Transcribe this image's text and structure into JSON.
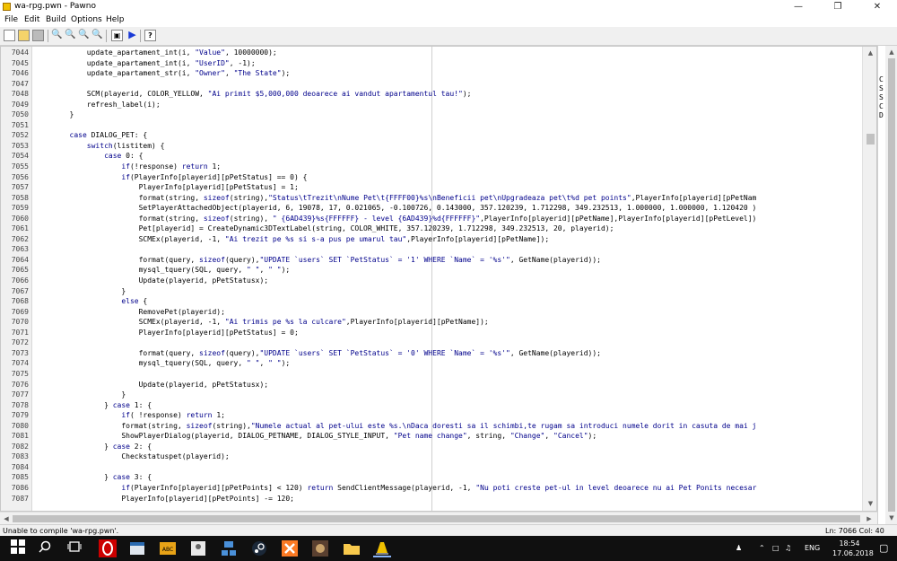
{
  "window": {
    "title": "wa-rpg.pwn - Pawno",
    "minimize": "—",
    "maximize": "❐",
    "close": "✕"
  },
  "menu": [
    "File",
    "Edit",
    "Build",
    "Options",
    "Help"
  ],
  "toolbar": {
    "icons": [
      "new-file-icon",
      "open-file-icon",
      "save-icon",
      "find-icon",
      "find-next-icon",
      "replace-icon",
      "goto-line-icon",
      "compile-icon",
      "run-icon",
      "help-icon"
    ]
  },
  "editor": {
    "line_numbers": [
      "7044",
      "7045",
      "7046",
      "7047",
      "7048",
      "7049",
      "7050",
      "7051",
      "7052",
      "7053",
      "7054",
      "7055",
      "7056",
      "7057",
      "7058",
      "7059",
      "7060",
      "7061",
      "7062",
      "7063",
      "7064",
      "7065",
      "7066",
      "7067",
      "7068",
      "7069",
      "7070",
      "7071",
      "7072",
      "7073",
      "7074",
      "7075",
      "7076",
      "7077",
      "7078",
      "7079",
      "7080",
      "7081",
      "7082",
      "7083",
      "7084",
      "7085",
      "7086",
      "7087"
    ],
    "lines": [
      "            update_apartament_int(i, \"Value\", 10000000);",
      "            update_apartament_int(i, \"UserID\", -1);",
      "            update_apartament_str(i, \"Owner\", \"The State\");",
      "",
      "            SCM(playerid, COLOR_YELLOW, \"Ai primit $5,000,000 deoarece ai vandut apartamentul tau!\");",
      "            refresh_label(i);",
      "        }",
      "",
      "        case DIALOG_PET: {",
      "            switch(listitem) {",
      "                case 0: {",
      "                    if(!response) return 1;",
      "                    if(PlayerInfo[playerid][pPetStatus] == 0) {",
      "                        PlayerInfo[playerid][pPetStatus] = 1;",
      "                        format(string, sizeof(string),\"Status\\tTrezit\\nNume Pet\\t{FFFF00}%s\\nBeneficii pet\\nUpgradeaza pet\\t%d pet points\",PlayerInfo[playerid][pPetNam",
      "                        SetPlayerAttachedObject(playerid, 6, 19078, 17, 0.021065, -0.100726, 0.143000, 357.120239, 1.712298, 349.232513, 1.000000, 1.000000, 1.120420 )",
      "                        format(string, sizeof(string), \" {6AD439}%s{FFFFFF} - level {6AD439}%d{FFFFFF}\",PlayerInfo[playerid][pPetName],PlayerInfo[playerid][pPetLevel])",
      "                        Pet[playerid] = CreateDynamic3DTextLabel(string, COLOR_WHITE, 357.120239, 1.712298, 349.232513, 20, playerid);",
      "                        SCMEx(playerid, -1, \"Ai trezit pe %s si s-a pus pe umarul tau\",PlayerInfo[playerid][pPetName]);",
      "",
      "                        format(query, sizeof(query),\"UPDATE `users` SET `PetStatus` = '1' WHERE `Name` = '%s'\", GetName(playerid));",
      "                        mysql_tquery(SQL, query, \" \", \" \");",
      "                        Update(playerid, pPetStatusx);",
      "                    }",
      "                    else {",
      "                        RemovePet(playerid);",
      "                        SCMEx(playerid, -1, \"Ai trimis pe %s la culcare\",PlayerInfo[playerid][pPetName]);",
      "                        PlayerInfo[playerid][pPetStatus] = 0;",
      "",
      "                        format(query, sizeof(query),\"UPDATE `users` SET `PetStatus` = '0' WHERE `Name` = '%s'\", GetName(playerid));",
      "                        mysql_tquery(SQL, query, \" \", \" \");",
      "",
      "                        Update(playerid, pPetStatusx);",
      "                    }",
      "                } case 1: {",
      "                    if( !response) return 1;",
      "                    format(string, sizeof(string),\"Numele actual al pet-ului este %s.\\nDaca doresti sa il schimbi,te rugam sa introduci numele dorit in casuta de mai j",
      "                    ShowPlayerDialog(playerid, DIALOG_PETNAME, DIALOG_STYLE_INPUT, \"Pet name change\", string, \"Change\", \"Cancel\");",
      "                } case 2: {",
      "                    Checkstatuspet(playerid);",
      "",
      "                } case 3: {",
      "                    if(PlayerInfo[playerid][pPetPoints] < 120) return SendClientMessage(playerid, -1, \"Nu poti creste pet-ul in level deoarece nu ai Pet Ponits necesar",
      "                    PlayerInfo[playerid][pPetPoints] -= 120;"
    ]
  },
  "right_panel": {
    "letters": [
      "C",
      "S",
      "S",
      "C",
      "D"
    ]
  },
  "status": {
    "message": "Unable to compile 'wa-rpg.pwn'.",
    "position": "Ln: 7066  Col: 40"
  },
  "taskbar": {
    "apps": [
      "start-icon",
      "search-icon",
      "task-view-icon",
      "opera-icon",
      "file-manager-icon",
      "app-icon",
      "people-icon",
      "network-icon",
      "steam-icon",
      "xampp-icon",
      "game-icon",
      "folder-icon",
      "pawno-icon"
    ],
    "tray_text": "ENG",
    "time": "18:54",
    "date": "17.06.2018"
  }
}
